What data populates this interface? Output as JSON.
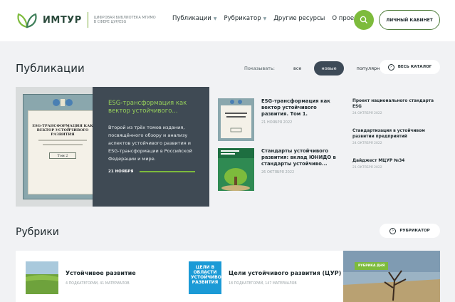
{
  "header": {
    "logo_name": "ИМТУР",
    "logo_subtitle": "Цифровая библиотека МГИМО в сфере ЦУР/ESG",
    "nav": [
      {
        "label": "Публикации",
        "has_dropdown": true
      },
      {
        "label": "Рубрикатор",
        "has_dropdown": true
      },
      {
        "label": "Другие ресурсы",
        "has_dropdown": false
      },
      {
        "label": "О проекте",
        "has_dropdown": false
      }
    ],
    "cabinet_label": "Личный кабинет",
    "accent_color": "#7dbb3c"
  },
  "publications": {
    "title": "Публикации",
    "show_label": "Показывать:",
    "filters": [
      "все",
      "новые",
      "популярные"
    ],
    "active_filter": "новые",
    "catalog_label": "Весь каталог",
    "featured": {
      "title": "ESG-трансформация как вектор устойчивого...",
      "text": "Второй из трёх томов издания, посвящённого обзору и анализу аспектов устойчивого развития и ESG-трансформации в Российской Федерации и мире.",
      "date": "21 ноября",
      "cover_title": "ESG-ТРАНСФОРМАЦИЯ КАК ВЕКТОР УСТОЙЧИВОГО РАЗВИТИЯ",
      "cover_tom": "Том 2"
    },
    "middle": [
      {
        "title": "ESG-трансформация как вектор устойчивого развития. Том 1.",
        "date": "21 ноября 2022"
      },
      {
        "title": "Стандарты устойчивого развития: вклад ЮНИДО в стандарты устойчиво...",
        "date": "26 октября 2022"
      }
    ],
    "right": [
      {
        "title": "Проект национального стандарта ESG",
        "date": "24 октября 2022"
      },
      {
        "title": "Стандартизация в устойчивом развитии предприятий",
        "date": "24 октября 2022"
      },
      {
        "title": "Дайджест МЦУР №34",
        "date": "21 октября 2022"
      }
    ]
  },
  "rubrics": {
    "title": "Рубрики",
    "button_label": "Рубрикатор",
    "items": [
      {
        "name": "Устойчивое развитие",
        "meta": "4 подкатегории, 41 материалов"
      },
      {
        "name": "Цели устойчивого развития (ЦУР)",
        "meta": "18 подкатегорий, 147 материалов"
      }
    ],
    "sdg_icon_text": "ЦЕЛИ В ОБЛАСТИ УСТОЙЧИВОГО РАЗВИТИЯ",
    "photo_badge": "Рубрика дня"
  }
}
